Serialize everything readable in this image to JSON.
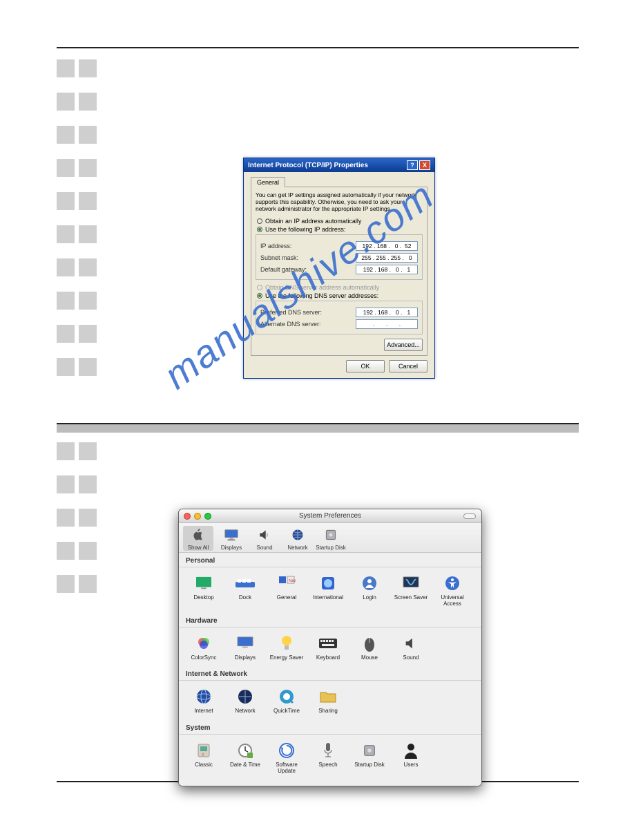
{
  "watermark": "manualshive.com",
  "xp": {
    "title": "Internet Protocol (TCP/IP) Properties",
    "tab": "General",
    "desc": "You can get IP settings assigned automatically if your network supports this capability. Otherwise, you need to ask your network administrator for the appropriate IP settings.",
    "radio_auto": "Obtain an IP address automatically",
    "radio_manual": "Use the following IP address:",
    "ip_label": "IP address:",
    "ip_value": "192 . 168 .   0 .  52",
    "mask_label": "Subnet mask:",
    "mask_value": "255 . 255 . 255 .   0",
    "gw_label": "Default gateway:",
    "gw_value": "192 . 168 .   0 .   1",
    "radio_dns_auto": "Obtain DNS server address automatically",
    "radio_dns_manual": "Use the following DNS server addresses:",
    "dns1_label": "Preferred DNS server:",
    "dns1_value": "192 . 168 .   0 .   1",
    "dns2_label": "Alternate DNS server:",
    "dns2_value": ".       .       .",
    "btn_adv": "Advanced...",
    "btn_ok": "OK",
    "btn_cancel": "Cancel"
  },
  "mac": {
    "title": "System Preferences",
    "toolbar": {
      "show_all": "Show All",
      "displays": "Displays",
      "sound": "Sound",
      "network": "Network",
      "startup_disk": "Startup Disk"
    },
    "sections": {
      "personal": "Personal",
      "hardware": "Hardware",
      "inet": "Internet & Network",
      "system": "System"
    },
    "personal": {
      "desktop": "Desktop",
      "dock": "Dock",
      "general": "General",
      "intl": "International",
      "login": "Login",
      "ssaver": "Screen Saver",
      "uaccess": "Universal\nAccess"
    },
    "hardware": {
      "colorsync": "ColorSync",
      "displays": "Displays",
      "energy": "Energy Saver",
      "keyboard": "Keyboard",
      "mouse": "Mouse",
      "sound": "Sound"
    },
    "inet": {
      "internet": "Internet",
      "network": "Network",
      "qt": "QuickTime",
      "sharing": "Sharing"
    },
    "system": {
      "classic": "Classic",
      "datetime": "Date & Time",
      "swupdate": "Software\nUpdate",
      "speech": "Speech",
      "startup": "Startup Disk",
      "users": "Users"
    }
  }
}
